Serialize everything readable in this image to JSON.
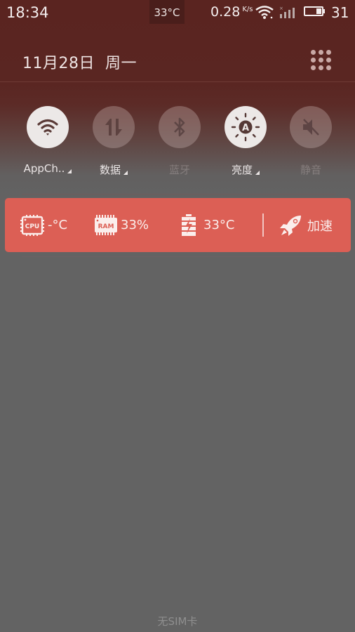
{
  "status_bar": {
    "time": "18:34",
    "temperature": "33°C",
    "net_speed": "0.28",
    "net_speed_unit": "K/s",
    "battery_level": "31",
    "icons": [
      "wifi-icon",
      "signal-no-sim-icon",
      "battery-icon"
    ]
  },
  "header": {
    "date": "11月28日  周一",
    "menu_icon": "grid-menu-icon"
  },
  "toggles": [
    {
      "label": "AppCh..",
      "icon": "wifi-icon",
      "state": "on",
      "has_menu": true
    },
    {
      "label": "数据",
      "icon": "data-arrows-icon",
      "state": "off",
      "has_menu": true
    },
    {
      "label": "蓝牙",
      "icon": "bluetooth-icon",
      "state": "disabled",
      "has_menu": false
    },
    {
      "label": "亮度",
      "icon": "auto-brightness-icon",
      "state": "on",
      "has_menu": true
    },
    {
      "label": "静音",
      "icon": "mute-icon",
      "state": "disabled",
      "has_menu": false
    }
  ],
  "speed_bar": {
    "accent_color": "#dc5f55",
    "cpu": {
      "chip_label": "CPU",
      "value": "-°C"
    },
    "ram": {
      "chip_label": "RAM",
      "value": "33%"
    },
    "battery": {
      "value": "33°C"
    },
    "boost": {
      "label": "加速",
      "icon": "rocket-icon"
    }
  },
  "footer": {
    "sim_status": "无SIM卡"
  }
}
